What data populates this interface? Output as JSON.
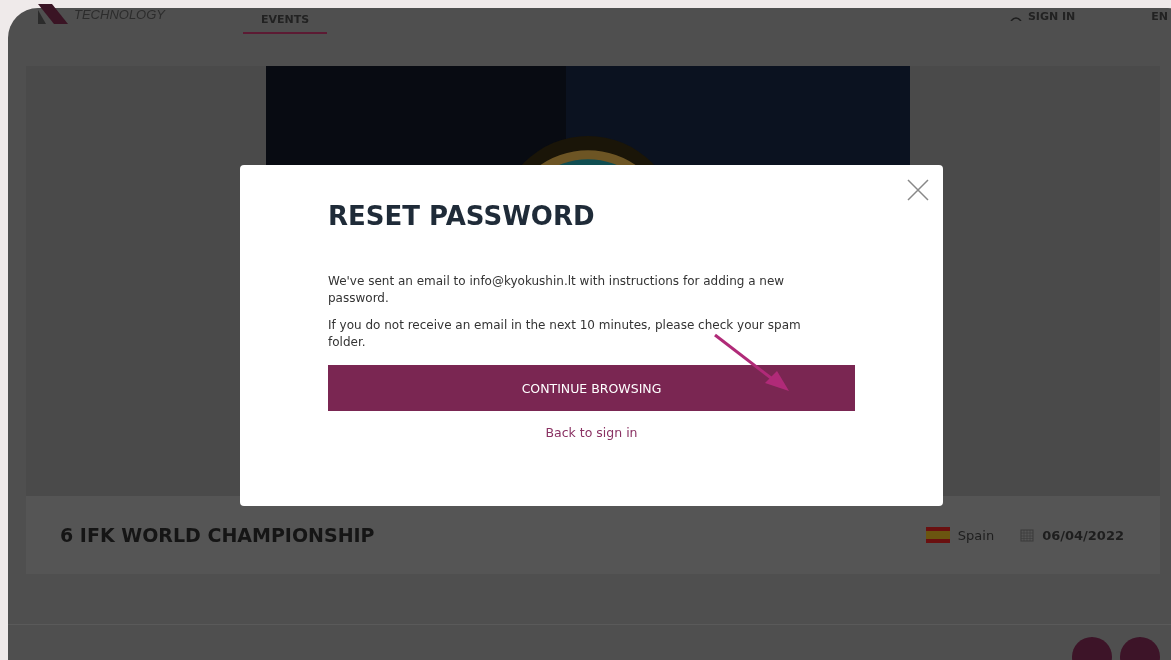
{
  "header": {
    "logo_text": "TECHNOLOGY",
    "nav": [
      {
        "label": "EVENTS",
        "selected": true
      }
    ],
    "sign_in": "SIGN IN",
    "language": "EN"
  },
  "event": {
    "title": "6 IFK WORLD CHAMPIONSHIP",
    "country": "Spain",
    "date": "06/04/2022"
  },
  "modal": {
    "title": "RESET PASSWORD",
    "paragraphs": [
      "We've sent an email to info@kyokushin.lt with instructions for adding a new password.",
      "If you do not receive an email in the next 10 minutes, please check your spam folder."
    ],
    "primary_button": "CONTINUE BROWSING",
    "link": "Back to sign in"
  }
}
